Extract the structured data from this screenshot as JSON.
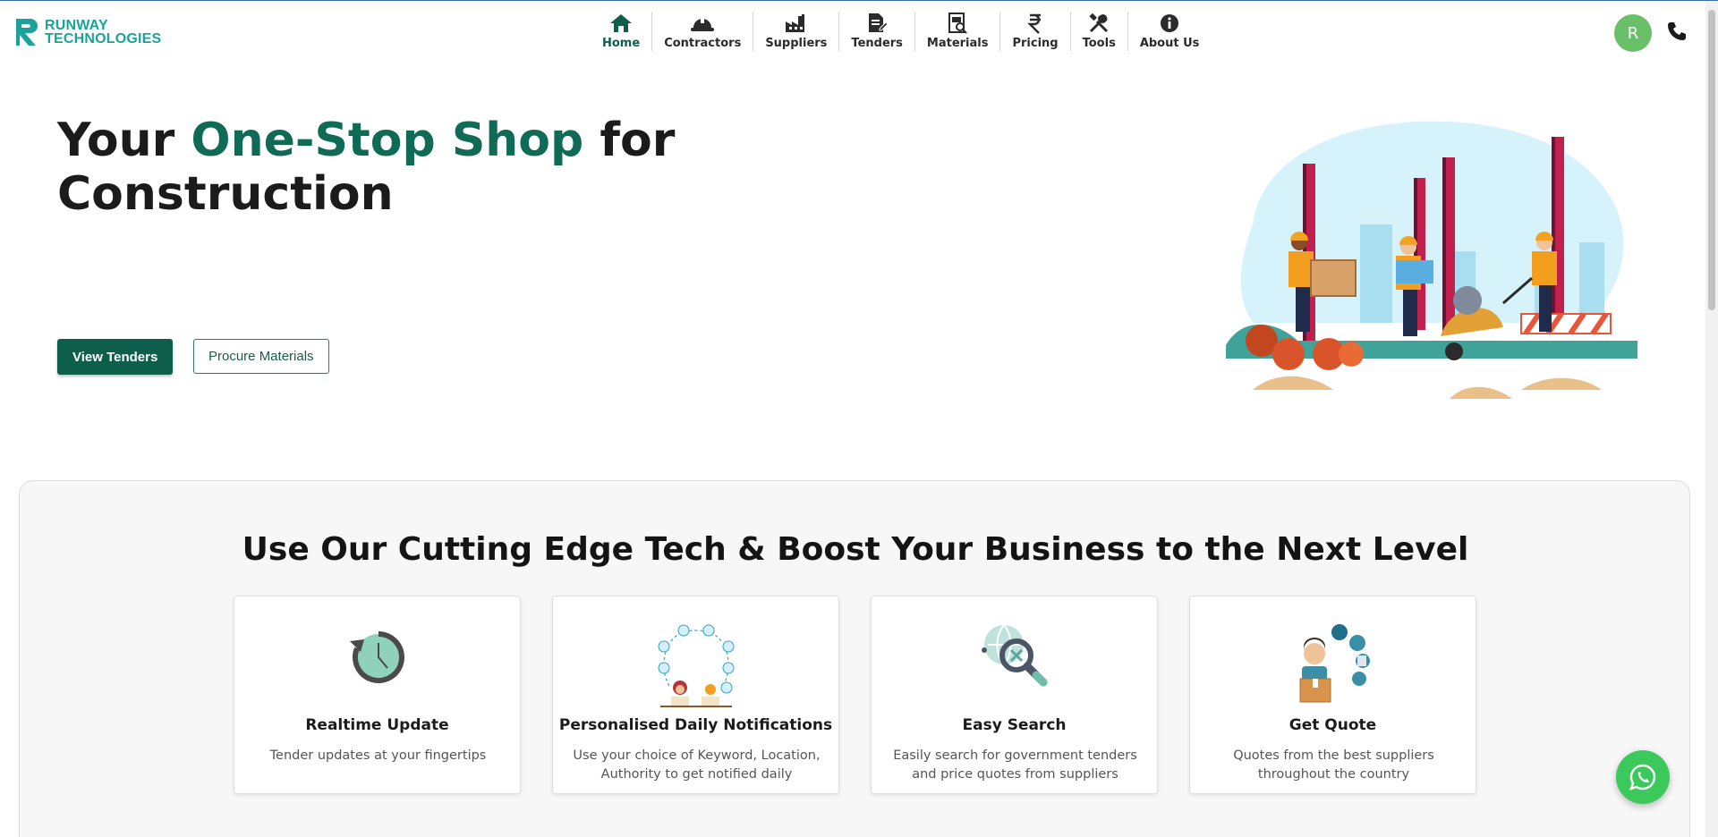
{
  "brand": {
    "line1": "RUNWAY",
    "line2": "TECHNOLOGIES",
    "color": "#1aa39a"
  },
  "nav": {
    "items": [
      {
        "label": "Home",
        "icon": "home-icon",
        "active": true
      },
      {
        "label": "Contractors",
        "icon": "hardhat-icon"
      },
      {
        "label": "Suppliers",
        "icon": "factory-icon"
      },
      {
        "label": "Tenders",
        "icon": "document-edit-icon"
      },
      {
        "label": "Materials",
        "icon": "materials-icon"
      },
      {
        "label": "Pricing",
        "icon": "rupee-icon"
      },
      {
        "label": "Tools",
        "icon": "tools-icon"
      },
      {
        "label": "About Us",
        "icon": "info-icon"
      }
    ]
  },
  "user": {
    "avatar_initial": "R",
    "avatar_color": "#6abf69"
  },
  "hero": {
    "title_prefix": "Your",
    "title_accent": "One-Stop Shop",
    "title_suffix": "for",
    "title_line2": "Construction",
    "primary_button": "View Tenders",
    "secondary_button": "Procure Materials"
  },
  "features": {
    "heading": "Use Our Cutting Edge Tech & Boost Your Business to the Next Level",
    "cards": [
      {
        "title": "Realtime Update",
        "text": "Tender updates at your fingertips",
        "icon": "clock-refresh-icon"
      },
      {
        "title": "Personalised Daily Notifications",
        "text": "Use your choice of Keyword, Location, Authority to get notified daily",
        "icon": "notifications-network-icon"
      },
      {
        "title": "Easy Search",
        "text": "Easily search for government tenders and price quotes from suppliers",
        "icon": "globe-search-icon"
      },
      {
        "title": "Get Quote",
        "text": "Quotes from the best suppliers throughout the country",
        "icon": "quote-person-icon"
      }
    ]
  },
  "colors": {
    "primary": "#0d5f4c",
    "accent_text": "#0f6b55",
    "whatsapp": "#3cc95c"
  }
}
